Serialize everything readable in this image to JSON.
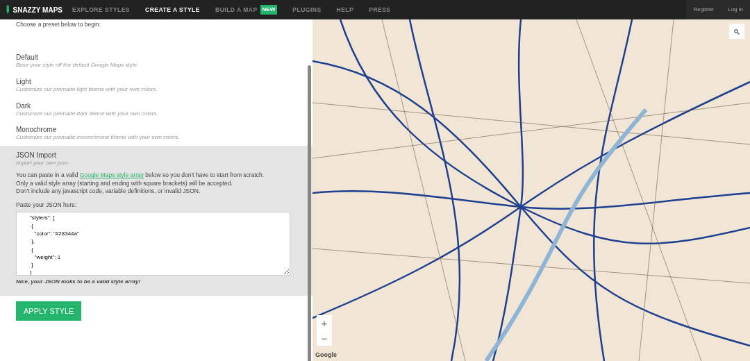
{
  "navbar": {
    "brand": "SNAZZY MAPS",
    "items": [
      {
        "label": "EXPLORE STYLES",
        "selected": false
      },
      {
        "label": "CREATE A STYLE",
        "selected": true
      },
      {
        "label": "BUILD A MAP",
        "selected": false,
        "badge": "NEW"
      },
      {
        "label": "PLUGINS",
        "selected": false
      },
      {
        "label": "HELP",
        "selected": false
      },
      {
        "label": "PRESS",
        "selected": false
      }
    ],
    "account": [
      "Register",
      "Log in"
    ]
  },
  "panel": {
    "intro": "Choose a preset below to begin:",
    "presets": [
      {
        "title": "Default",
        "subtitle": "Base your style off the default Google Maps style.",
        "selected": false
      },
      {
        "title": "Light",
        "subtitle": "Customize our premade light theme with your own colors.",
        "selected": false
      },
      {
        "title": "Dark",
        "subtitle": "Customize our premade dark theme with your own colors.",
        "selected": false
      },
      {
        "title": "Monochrome",
        "subtitle": "Customize our premade monochrome theme with your own colors.",
        "selected": false
      },
      {
        "title": "JSON Import",
        "subtitle": "Import your own json.",
        "selected": true
      }
    ],
    "import": {
      "text_before": "You can paste in a valid ",
      "link": "Google Maps style array",
      "text_after": " below so you don't have to start from scratch.",
      "lines": [
        "Only a valid style array (starting and ending with square brackets) will be accepted.",
        "Don't include any javascript code, variable definitions, or invalid JSON."
      ],
      "field_label": "Paste your JSON here:",
      "value": "    \"stylers\": [\n     {\n       \"color\": \"#28344a\"\n     },\n     {\n       \"weight\": 1\n     }\n    ]",
      "message": "Nice, your JSON looks to be a valid style array!"
    },
    "apply_button": "APPLY STYLE"
  },
  "map": {
    "zoom_in": "+",
    "zoom_out": "−",
    "attribution": "Google"
  }
}
